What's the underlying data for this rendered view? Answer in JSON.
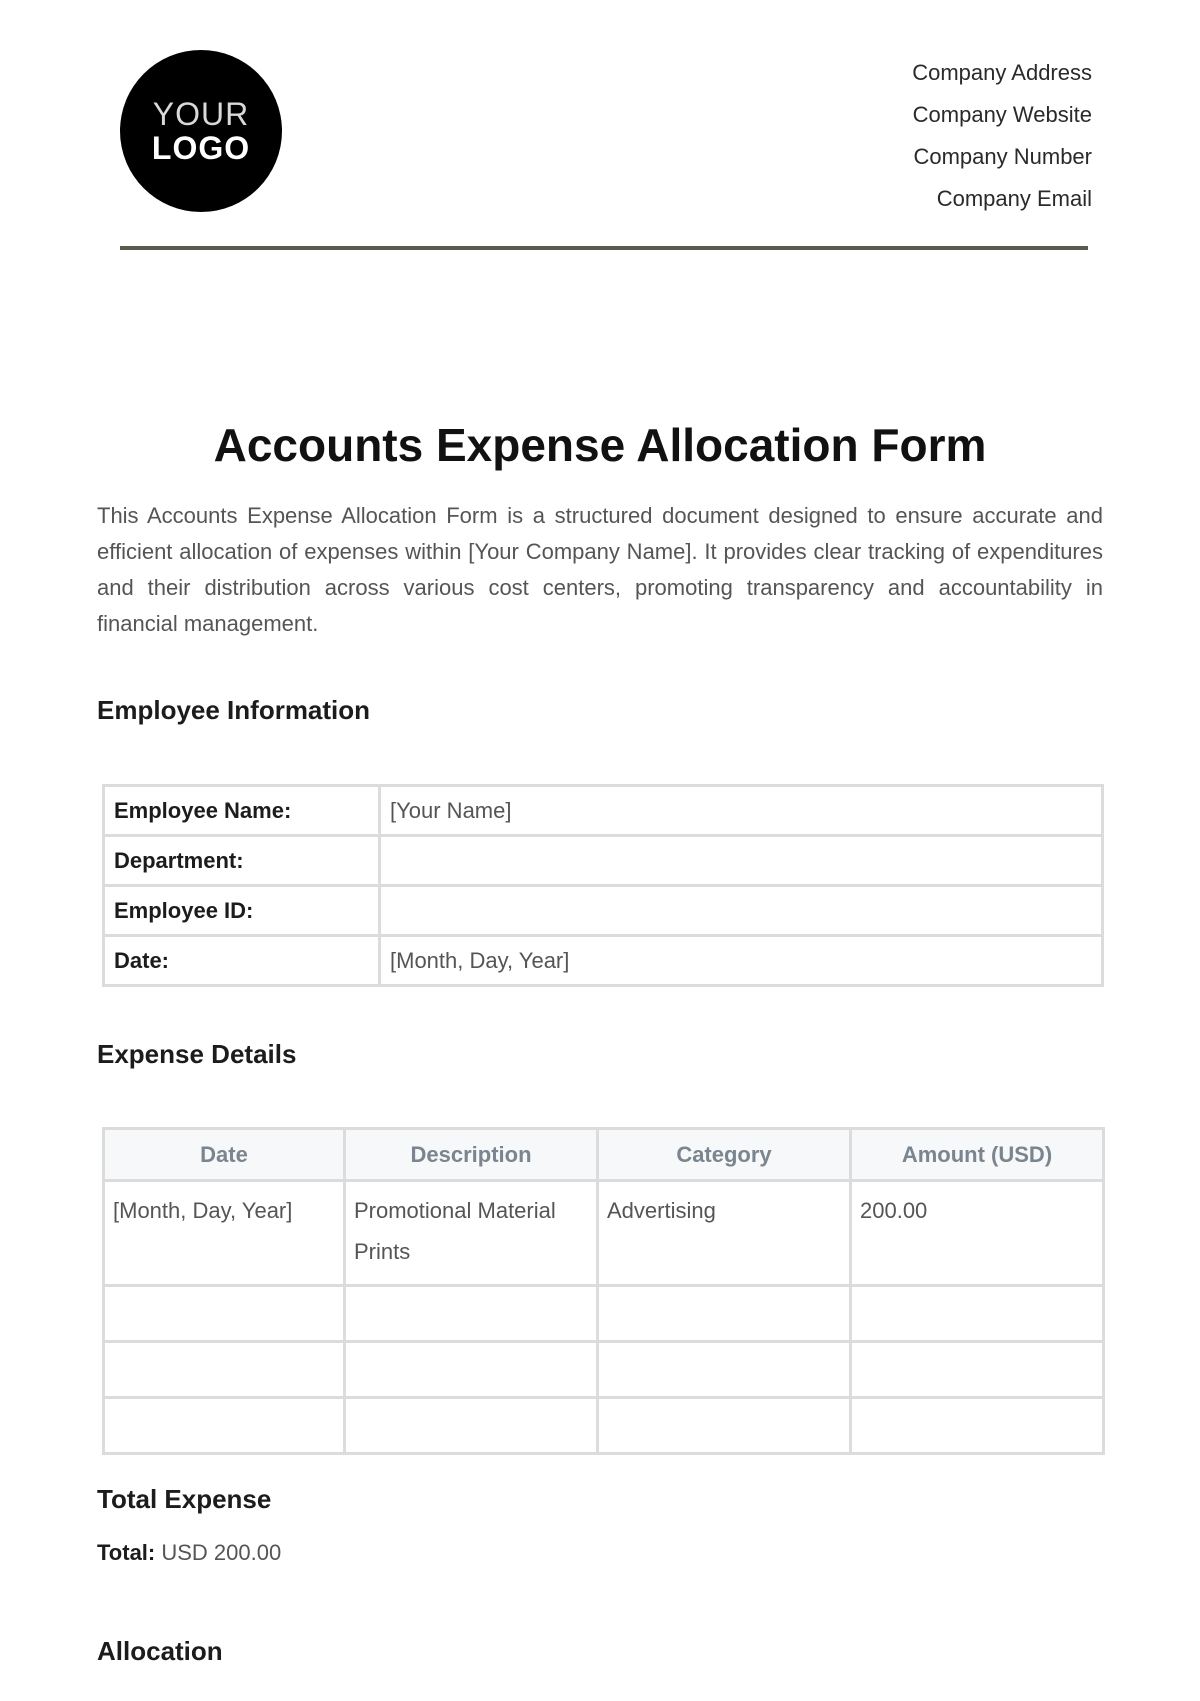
{
  "header": {
    "logo_line1": "YOUR",
    "logo_line2": "LOGO",
    "company_lines": [
      "Company Address",
      "Company Website",
      "Company Number",
      "Company Email"
    ]
  },
  "title": "Accounts Expense Allocation Form",
  "intro": "This Accounts Expense Allocation Form is a structured document designed to ensure accurate and efficient allocation of expenses within [Your Company Name]. It provides clear tracking of expenditures and their distribution across various cost centers, promoting transparency and accountability in financial management.",
  "employee_info": {
    "heading": "Employee Information",
    "rows": [
      {
        "label": "Employee Name:",
        "value": "[Your Name]"
      },
      {
        "label": "Department:",
        "value": ""
      },
      {
        "label": "Employee ID:",
        "value": ""
      },
      {
        "label": "Date:",
        "value": "[Month, Day, Year]"
      }
    ]
  },
  "expense_details": {
    "heading": "Expense Details",
    "columns": [
      "Date",
      "Description",
      "Category",
      "Amount (USD)"
    ],
    "rows": [
      [
        "[Month, Day, Year]",
        "Promotional Material Prints",
        "Advertising",
        "200.00"
      ],
      [
        "",
        "",
        "",
        ""
      ],
      [
        "",
        "",
        "",
        ""
      ],
      [
        "",
        "",
        "",
        ""
      ]
    ]
  },
  "total_expense": {
    "heading": "Total Expense",
    "label": "Total:",
    "value": "USD 200.00"
  },
  "allocation": {
    "heading": "Allocation"
  }
}
